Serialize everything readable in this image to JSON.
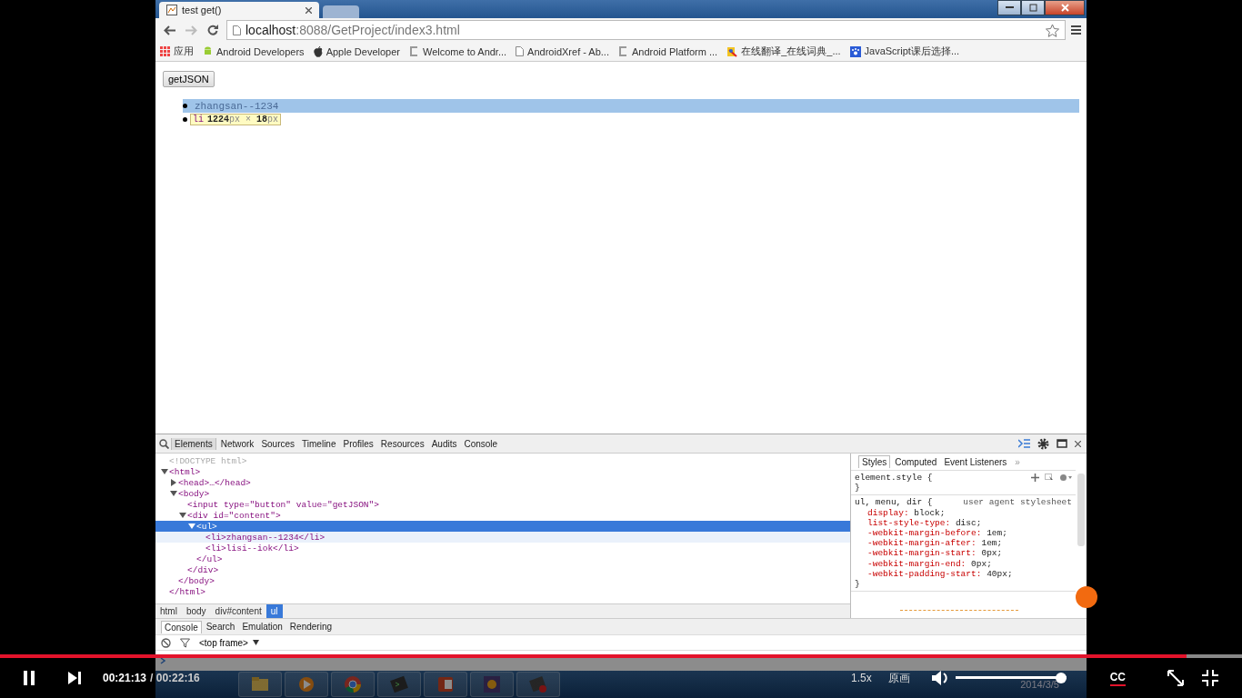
{
  "browser": {
    "tabs": [
      {
        "title": "test get()",
        "selected": true
      },
      {
        "selected": false
      }
    ],
    "address": {
      "host": "localhost",
      "path": ":8088/GetProject/index3.html"
    },
    "bookmarks": [
      {
        "kind": "apps",
        "label": "应用"
      },
      {
        "kind": "android",
        "label": "Android Developers"
      },
      {
        "kind": "apple",
        "label": "Apple Developer"
      },
      {
        "kind": "bracket",
        "label": "Welcome to Andr..."
      },
      {
        "kind": "page",
        "label": "AndroidXref - Ab..."
      },
      {
        "kind": "bracket",
        "label": "Android Platform ..."
      },
      {
        "kind": "dict",
        "label": "在线翻译_在线词典_..."
      },
      {
        "kind": "paw",
        "label": "JavaScript课后选择..."
      }
    ]
  },
  "page": {
    "button": "getJSON",
    "items": [
      {
        "text": "zhangsan--1234",
        "highlighted": true
      },
      {
        "highlighted": false
      }
    ],
    "tooltip": {
      "tag": "li",
      "size": "**1224**px × **18**px"
    }
  },
  "devtools": {
    "tabs": [
      {
        "label": "Elements",
        "selected": true
      },
      {
        "label": "Network",
        "selected": false
      },
      {
        "label": "Sources",
        "selected": false
      },
      {
        "label": "Timeline",
        "selected": false
      },
      {
        "label": "Profiles",
        "selected": false
      },
      {
        "label": "Resources",
        "selected": false
      },
      {
        "label": "Audits",
        "selected": false
      },
      {
        "label": "Console",
        "selected": false
      }
    ],
    "dom": [
      {
        "kind": "doctype",
        "tag": "<!DOCTYPE html>",
        "selected": false,
        "hovered": false
      },
      {
        "kind": "element",
        "tag": "<html>",
        "expanded": true,
        "selected": false,
        "hovered": false,
        "end": "</html>",
        "children": [
          {
            "kind": "element",
            "tag": "<head>…</head>",
            "expanded": false,
            "selected": false,
            "hovered": false
          },
          {
            "kind": "element",
            "tag": "<body>",
            "expanded": true,
            "selected": false,
            "hovered": false,
            "end": "</body>",
            "children": [
              {
                "kind": "element",
                "tag": "<input type=\"button\" value=\"getJSON\">",
                "selected": false,
                "hovered": false
              },
              {
                "kind": "element",
                "tag": "<div id=\"content\">",
                "expanded": true,
                "selected": false,
                "hovered": false,
                "end": "</div>",
                "children": [
                  {
                    "kind": "element",
                    "tag": "<ul>",
                    "expanded": true,
                    "selected": true,
                    "hovered": false,
                    "end": "</ul>",
                    "children": [
                      {
                        "kind": "element",
                        "tag": "<li>zhangsan--1234</li>",
                        "selected": false,
                        "hovered": true
                      },
                      {
                        "kind": "element",
                        "tag": "<li>lisi--iok</li>",
                        "selected": false,
                        "hovered": false
                      }
                    ]
                  }
                ]
              }
            ]
          }
        ]
      }
    ],
    "breadcrumbs": [
      {
        "label": "html",
        "selected": false
      },
      {
        "label": "body",
        "selected": false
      },
      {
        "label": "div#content",
        "selected": false
      },
      {
        "label": "ul",
        "selected": true
      }
    ],
    "styles_tabs": [
      {
        "label": "Styles",
        "selected": true
      },
      {
        "label": "Computed",
        "selected": false
      },
      {
        "label": "Event Listeners",
        "selected": false
      }
    ],
    "more": "»",
    "rules": [
      {
        "kind": "inline",
        "selector": "element.style {",
        "close": "}"
      },
      {
        "kind": "agent",
        "selector": "ul, menu, dir {",
        "origin": "user agent stylesheet",
        "close": "}",
        "properties": [
          {
            "name": "display:",
            "value": "block;"
          },
          {
            "name": "list-style-type:",
            "value": "disc;"
          },
          {
            "name": "-webkit-margin-before:",
            "value": "1em;"
          },
          {
            "name": "-webkit-margin-after:",
            "value": "1em;"
          },
          {
            "name": "-webkit-margin-start:",
            "value": "0px;"
          },
          {
            "name": "-webkit-margin-end:",
            "value": "0px;"
          },
          {
            "name": "-webkit-padding-start:",
            "value": "40px;"
          }
        ]
      }
    ],
    "drawer_tabs": [
      {
        "label": "Console",
        "selected": true
      },
      {
        "label": "Search",
        "selected": false
      },
      {
        "label": "Emulation",
        "selected": false
      },
      {
        "label": "Rendering",
        "selected": false
      }
    ],
    "context": "<top frame>"
  },
  "taskbar": {
    "apps": [
      {
        "kind": "folder"
      },
      {
        "kind": "media"
      },
      {
        "kind": "chrome"
      },
      {
        "kind": "terminal"
      },
      {
        "kind": "slides"
      },
      {
        "kind": "ide"
      },
      {
        "kind": "tool"
      }
    ],
    "date": "2014/3/5"
  },
  "player": {
    "progress": {
      "level": 0.955
    },
    "time": "00:21:13",
    "duration": "/ 00:22:16",
    "speed": "1.5x",
    "quality": "原画",
    "volume": {
      "level": 1
    },
    "captions": "CC"
  }
}
